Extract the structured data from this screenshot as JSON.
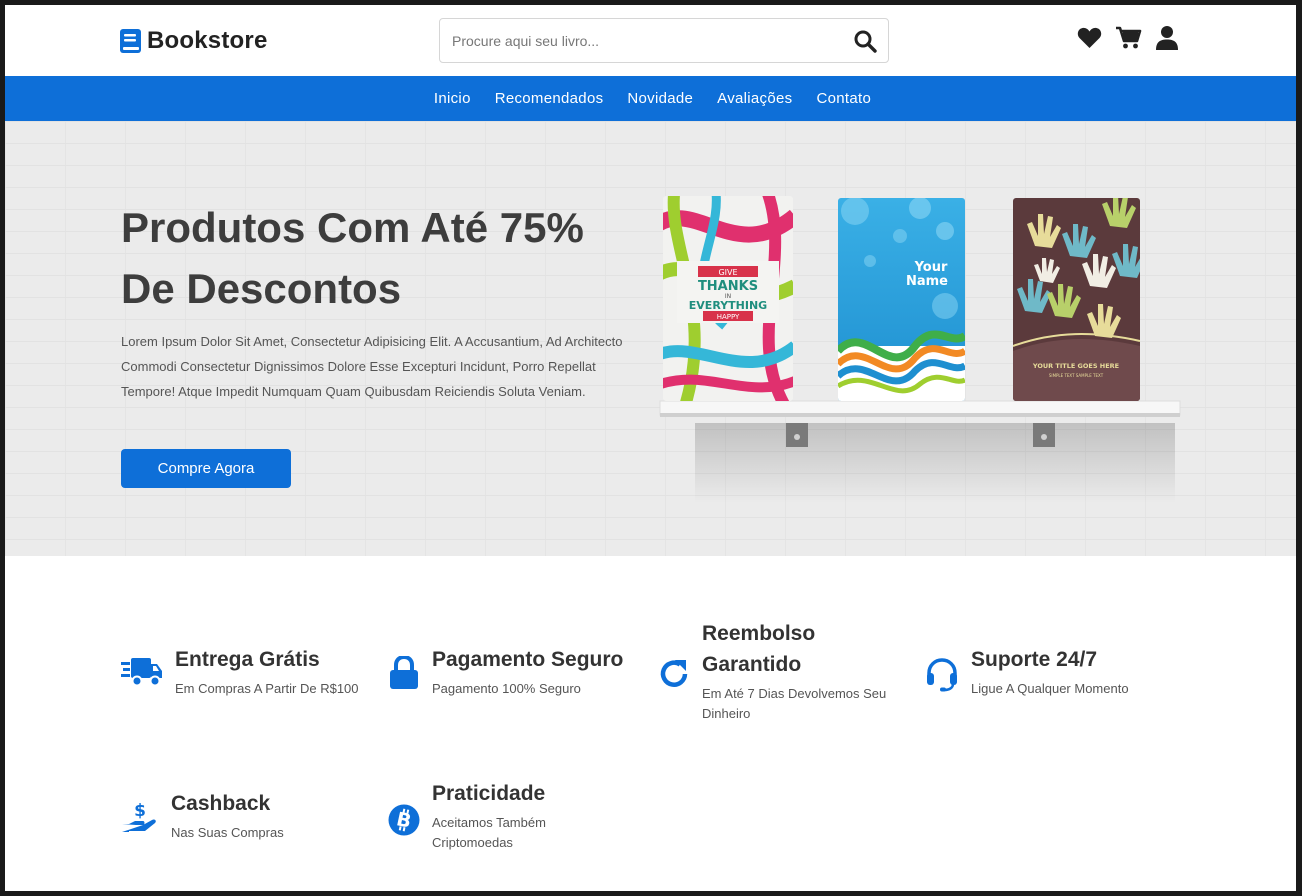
{
  "header": {
    "logo_text": "Bookstore",
    "search_placeholder": "Procure aqui seu livro..."
  },
  "nav": {
    "items": [
      "Inicio",
      "Recomendados",
      "Novidade",
      "Avaliações",
      "Contato"
    ]
  },
  "hero": {
    "title": "Produtos Com Até 75% De Descontos",
    "description": "Lorem Ipsum Dolor Sit Amet, Consectetur Adipisicing Elit. A Accusantium, Ad Architecto Commodi Consectetur Dignissimos Dolore Esse Excepturi Incidunt, Porro Repellat Tempore! Atque Impedit Numquam Quam Quibusdam Reiciendis Soluta Veniam.",
    "button_label": "Compre Agora",
    "book1": {
      "line1": "GIVE",
      "line2": "THANKS",
      "line3": "IN",
      "line4": "EVERYTHING",
      "line5": "HAPPY"
    },
    "book2": {
      "line1": "Your",
      "line2": "Name"
    },
    "book3": {
      "line1": "YOUR TITLE GOES HERE",
      "line2": "SIMPLE TEXT SAMPLE TEXT"
    }
  },
  "features": [
    {
      "title": "Entrega Grátis",
      "subtitle": "Em Compras A Partir De R$100",
      "icon": "truck-icon"
    },
    {
      "title": "Pagamento Seguro",
      "subtitle": "Pagamento 100% Seguro",
      "icon": "lock-icon"
    },
    {
      "title": "Reembolso Garantido",
      "subtitle": "Em Até 7 Dias Devolvemos Seu Dinheiro",
      "icon": "refresh-icon"
    },
    {
      "title": "Suporte 24/7",
      "subtitle": "Ligue A Qualquer Momento",
      "icon": "headset-icon"
    },
    {
      "title": "Cashback",
      "subtitle": "Nas Suas Compras",
      "icon": "cashback-icon"
    },
    {
      "title": "Praticidade",
      "subtitle": "Aceitamos Também Criptomoedas",
      "icon": "bitcoin-icon"
    }
  ],
  "colors": {
    "accent": "#0e6fd8",
    "text": "#333333"
  }
}
